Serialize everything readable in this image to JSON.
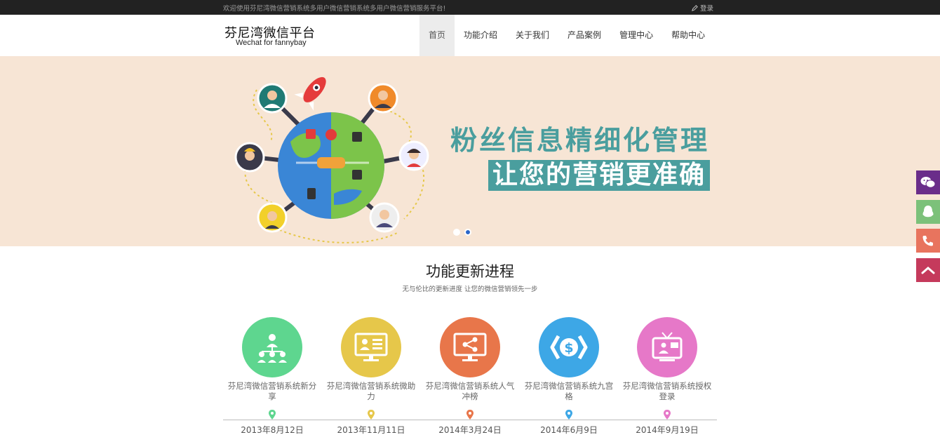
{
  "topbar": {
    "welcome": "欢迎使用芬尼湾微信营销系统多用户微信营销系统多用户微信营销服务平台!",
    "login": "登录"
  },
  "header": {
    "logo_title": "芬尼湾微信平台",
    "logo_subtitle": "Wechat for fannybay",
    "nav": [
      {
        "label": "首页",
        "active": true
      },
      {
        "label": "功能介绍"
      },
      {
        "label": "关于我们"
      },
      {
        "label": "产品案例"
      },
      {
        "label": "管理中心"
      },
      {
        "label": "帮助中心"
      }
    ]
  },
  "banner": {
    "slogan_line1": "粉丝信息精细化管理",
    "slogan_line2": "让您的营销更准确",
    "background": "#f7e5d5",
    "accent": "#4a9e9e",
    "active_slide": 2,
    "slide_count": 2
  },
  "side_buttons": [
    {
      "icon": "wechat-icon",
      "color": "#6a2d8a"
    },
    {
      "icon": "qq-icon",
      "color": "#7cc17a"
    },
    {
      "icon": "phone-icon",
      "color": "#e8745e"
    },
    {
      "icon": "back-to-top-icon",
      "color": "#c53a5c"
    }
  ],
  "section": {
    "title": "功能更新进程",
    "subtitle": "无与伦比的更新进度 让您的微信营销领先一步"
  },
  "features": [
    {
      "label": "芬尼湾微信营销系统新分享",
      "date": "2013年8月12日",
      "color": "#5ed68f",
      "icon": "share-network-icon"
    },
    {
      "label": "芬尼湾微信营销系统微助力",
      "date": "2013年11月11日",
      "color": "#e6c74a",
      "icon": "monitor-profile-icon"
    },
    {
      "label": "芬尼湾微信营销系统人气冲榜",
      "date": "2014年3月24日",
      "color": "#e8764a",
      "icon": "monitor-share-icon"
    },
    {
      "label": "芬尼湾微信营销系统九宫格",
      "date": "2014年6月9日",
      "color": "#3da7e6",
      "icon": "dollar-code-icon"
    },
    {
      "label": "芬尼湾微信营销系统授权登录",
      "date": "2014年9月19日",
      "color": "#e678c8",
      "icon": "tv-o2o-icon"
    }
  ]
}
